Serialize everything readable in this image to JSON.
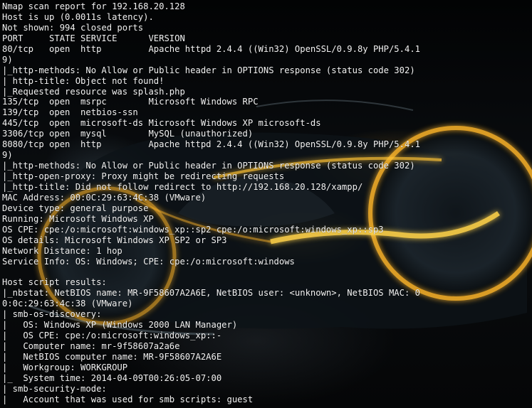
{
  "terminal": {
    "lines": [
      "Nmap scan report for 192.168.20.128",
      "Host is up (0.0011s latency).",
      "Not shown: 994 closed ports",
      "PORT     STATE SERVICE      VERSION",
      "80/tcp   open  http         Apache httpd 2.4.4 ((Win32) OpenSSL/0.9.8y PHP/5.4.1",
      "9)",
      "|_http-methods: No Allow or Public header in OPTIONS response (status code 302)",
      "| http-title: Object not found!",
      "|_Requested resource was splash.php",
      "135/tcp  open  msrpc        Microsoft Windows RPC",
      "139/tcp  open  netbios-ssn",
      "445/tcp  open  microsoft-ds Microsoft Windows XP microsoft-ds",
      "3306/tcp open  mysql        MySQL (unauthorized)",
      "8080/tcp open  http         Apache httpd 2.4.4 ((Win32) OpenSSL/0.9.8y PHP/5.4.1",
      "9)",
      "|_http-methods: No Allow or Public header in OPTIONS response (status code 302)",
      "|_http-open-proxy: Proxy might be redirecting requests",
      "|_http-title: Did not follow redirect to http://192.168.20.128/xampp/",
      "MAC Address: 00:0C:29:63:4C:38 (VMware)",
      "Device type: general purpose",
      "Running: Microsoft Windows XP",
      "OS CPE: cpe:/o:microsoft:windows_xp::sp2 cpe:/o:microsoft:windows_xp::sp3",
      "OS details: Microsoft Windows XP SP2 or SP3",
      "Network Distance: 1 hop",
      "Service Info: OS: Windows; CPE: cpe:/o:microsoft:windows",
      "",
      "Host script results:",
      "|_nbstat: NetBIOS name: MR-9F58607A2A6E, NetBIOS user: <unknown>, NetBIOS MAC: 0",
      "0:0c:29:63:4c:38 (VMware)",
      "| smb-os-discovery:",
      "|   OS: Windows XP (Windows 2000 LAN Manager)",
      "|   OS CPE: cpe:/o:microsoft:windows_xp::-",
      "|   Computer name: mr-9f58607a2a6e",
      "|   NetBIOS computer name: MR-9F58607A2A6E",
      "|   Workgroup: WORKGROUP",
      "|_  System time: 2014-04-09T00:26:05-07:00",
      "| smb-security-mode:",
      "|   Account that was used for smb scripts: guest"
    ]
  }
}
